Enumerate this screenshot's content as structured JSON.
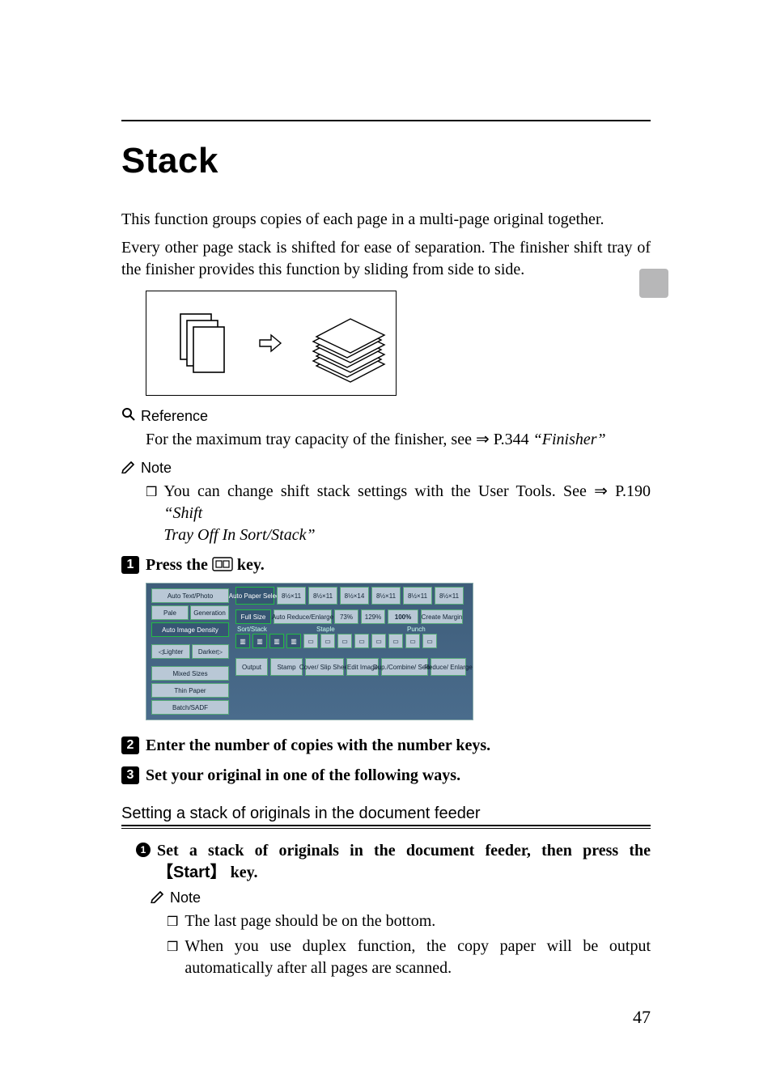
{
  "title": "Stack",
  "intro1": "This function groups copies of each page in a multi-page original together.",
  "intro2": "Every other page stack is shifted for ease of separation. The finisher shift tray of the finisher provides this function by sliding from side to side.",
  "reference": {
    "label": "Reference",
    "text_before": "For the maximum tray capacity of the finisher, see ",
    "arrow": "⇒",
    "page_ref": "P.344",
    "link_text": " “Finisher”"
  },
  "note_top": {
    "label": "Note",
    "text_before": "You can change shift stack settings with the User Tools. See ",
    "arrow": "⇒",
    "page_ref": "P.190",
    "link_text_prefix": " “Shift",
    "link_text_rest": "Tray Off In Sort/Stack”"
  },
  "steps": {
    "s1_prefix": "Press the ",
    "s1_icon_alt": "stack",
    "s1_suffix": " key.",
    "s2": "Enter the number of copies with the number keys.",
    "s3": "Set your original in one of the following ways."
  },
  "screenshot": {
    "left_col": [
      "Auto Text/Photo",
      "Pale",
      "Generation",
      "Auto Image Density",
      "Lighter",
      "Darker",
      "Mixed Sizes",
      "Thin Paper",
      "Batch/SADF"
    ],
    "top_row": [
      "Auto Paper Select",
      "8½×11",
      "8½×11",
      "8½×14",
      "8½×11",
      "8½×11",
      "8½×11"
    ],
    "mid_row_left": "Full Size",
    "mid_row_center": "Auto Reduce/Enlarge",
    "mid_row_vals": [
      "73%",
      "129%",
      "100%"
    ],
    "mid_row_right": "Create Margin",
    "labels": [
      "Sort/Stack",
      "Staple",
      "Punch"
    ],
    "bottom_row": [
      "Output",
      "Stamp",
      "Cover/ Slip Sheet",
      "Edit Image",
      "Dup./Combine/ Series",
      "Reduce/ Enlarge"
    ]
  },
  "subsection": {
    "title": "Setting a stack of originals in the document feeder",
    "sub1_before": "Set a stack of originals in the document feeder, then press the ",
    "sub1_key": "【Start】",
    "sub1_after": " key.",
    "note_label": "Note",
    "note1": "The last page should be on the bottom.",
    "note2": "When you use duplex function, the copy paper will be output automatically after all pages are scanned."
  },
  "page_number": "47"
}
